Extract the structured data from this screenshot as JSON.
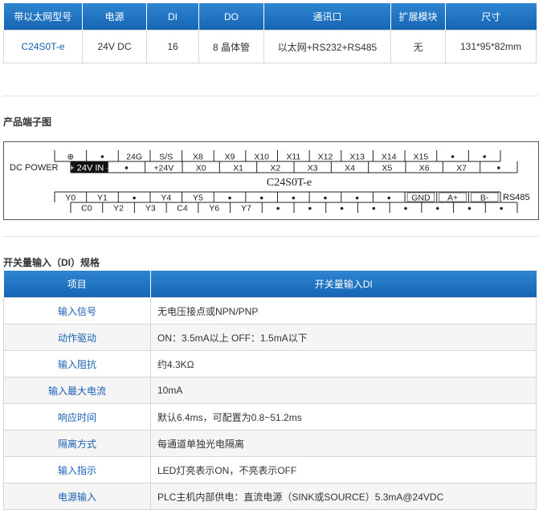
{
  "spec_table": {
    "headers": [
      "带以太网型号",
      "电源",
      "DI",
      "DO",
      "通讯口",
      "扩展模块",
      "尺寸"
    ],
    "row": [
      "C24S0T-e",
      "24V DC",
      "16",
      "8 晶体管",
      "以太网+RS232+RS485",
      "无",
      "131*95*82mm"
    ]
  },
  "terminal_section": {
    "title": "产品端子图",
    "left_label": "DC POWER",
    "right_label": "RS485",
    "model_label": "C24S0T-e",
    "top_row1": [
      "⊕",
      "•",
      "24G",
      "S/S",
      "X8",
      "X9",
      "X10",
      "X11",
      "X12",
      "X13",
      "X14",
      "X15",
      "•",
      "•"
    ],
    "top_row2": [
      "+ 24V IN -",
      "•",
      "+24V",
      "X0",
      "X1",
      "X2",
      "X3",
      "X4",
      "X5",
      "X6",
      "X7",
      "•"
    ],
    "bottom_row1": [
      "Y0",
      "Y1",
      "•",
      "Y4",
      "Y5",
      "•",
      "•",
      "•",
      "•",
      "•",
      "•",
      "GND",
      "A+",
      "B-"
    ],
    "bottom_row2": [
      "C0",
      "Y2",
      "Y3",
      "C4",
      "Y6",
      "Y7",
      "•",
      "•",
      "•",
      "•",
      "•",
      "•",
      "•",
      "•"
    ]
  },
  "di_section": {
    "title": "开关量输入（DI）规格",
    "headers": [
      "项目",
      "开关量输入DI"
    ],
    "rows": [
      [
        "输入信号",
        "无电压接点或NPN/PNP"
      ],
      [
        "动作驱动",
        "ON：3.5mA以上  OFF：1.5mA以下"
      ],
      [
        "输入阻抗",
        "约4.3KΩ"
      ],
      [
        "输入最大电流",
        "10mA"
      ],
      [
        "响应时间",
        "默认6.4ms，可配置为0.8~51.2ms"
      ],
      [
        "隔离方式",
        "每通道单独光电隔离"
      ],
      [
        "输入指示",
        "LED灯亮表示ON，不亮表示OFF"
      ],
      [
        "电源输入",
        "PLC主机内部供电：直流电源（SINK或SOURCE）5.3mA@24VDC"
      ]
    ]
  }
}
